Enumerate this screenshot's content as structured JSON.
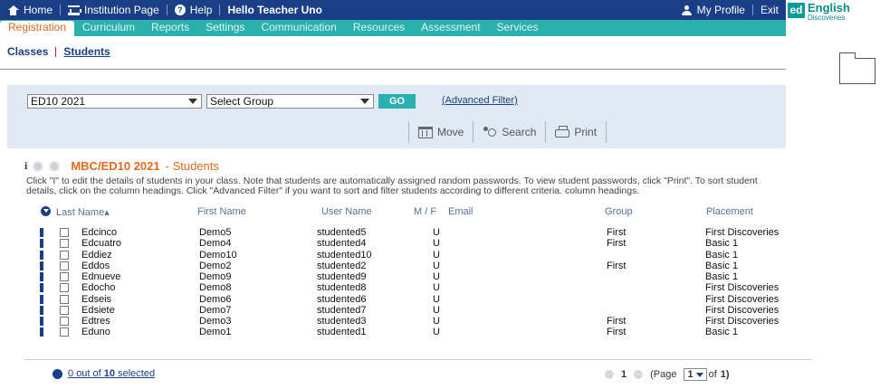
{
  "topbar": {
    "home": "Home",
    "institution": "Institution Page",
    "help": "Help",
    "greeting": "Hello Teacher Uno",
    "profile": "My Profile",
    "exit": "Exit"
  },
  "brand": {
    "logo": "ed",
    "name": "English",
    "sub": "Discoveries"
  },
  "menu": [
    "Registration",
    "Curriculum",
    "Reports",
    "Settings",
    "Communication",
    "Resources",
    "Assessment",
    "Services"
  ],
  "subnav": {
    "classes": "Classes",
    "students": "Students"
  },
  "filter": {
    "class_value": "ED10 2021",
    "group_value": "Select Group",
    "go": "GO",
    "advanced": "(Advanced Filter)"
  },
  "tools": {
    "move": "Move",
    "search": "Search",
    "print": "Print"
  },
  "class_heading": {
    "title": "MBC/ED10 2021",
    "suffix": "- Students"
  },
  "instructions": "Click \"I\" to edit the details of students in your class. Note that students are automatically assigned random passwords. To view student passwords, click \"Print\". To sort student details, click on the column headings. Click \"Advanced Filter\" if you want to sort and filter students according to different criteria. column headings.",
  "table": {
    "headers": {
      "last": "Last Name▴",
      "first": "First Name",
      "user": "User Name",
      "mf": "M / F",
      "email": "Email",
      "group": "Group",
      "placement": "Placement"
    },
    "rows": [
      {
        "last": "Edcinco",
        "first": "Demo5",
        "user": "studented5",
        "mf": "U",
        "group": "First",
        "placement": "First Discoveries"
      },
      {
        "last": "Edcuatro",
        "first": "Demo4",
        "user": "studented4",
        "mf": "U",
        "group": "First",
        "placement": "Basic 1"
      },
      {
        "last": "Eddiez",
        "first": "Demo10",
        "user": "studented10",
        "mf": "U",
        "group": "",
        "placement": "Basic 1"
      },
      {
        "last": "Eddos",
        "first": "Demo2",
        "user": "studented2",
        "mf": "U",
        "group": "First",
        "placement": "Basic 1"
      },
      {
        "last": "Ednueve",
        "first": "Demo9",
        "user": "studented9",
        "mf": "U",
        "group": "",
        "placement": "Basic 1"
      },
      {
        "last": "Edocho",
        "first": "Demo8",
        "user": "studented8",
        "mf": "U",
        "group": "",
        "placement": "First Discoveries"
      },
      {
        "last": "Edseis",
        "first": "Demo6",
        "user": "studented6",
        "mf": "U",
        "group": "",
        "placement": "First Discoveries"
      },
      {
        "last": "Edsiete",
        "first": "Demo7",
        "user": "studented7",
        "mf": "U",
        "group": "",
        "placement": "First Discoveries"
      },
      {
        "last": "Edtres",
        "first": "Demo3",
        "user": "studented3",
        "mf": "U",
        "group": "First",
        "placement": "First Discoveries"
      },
      {
        "last": "Eduno",
        "first": "Demo1",
        "user": "studented1",
        "mf": "U",
        "group": "First",
        "placement": "Basic 1"
      }
    ]
  },
  "footer": {
    "selected_count": "0",
    "selected_mid": "out of",
    "selected_total": "10",
    "selected_suffix": "selected",
    "page_current": "1",
    "page_prefix": "(Page",
    "page_select": "1",
    "page_of": "of",
    "page_total": "1)"
  },
  "colors": {
    "topbar": "#1a3f86",
    "menubar": "#2ab0ad",
    "accent": "#e06a1f",
    "panel": "#e1e9f3"
  }
}
